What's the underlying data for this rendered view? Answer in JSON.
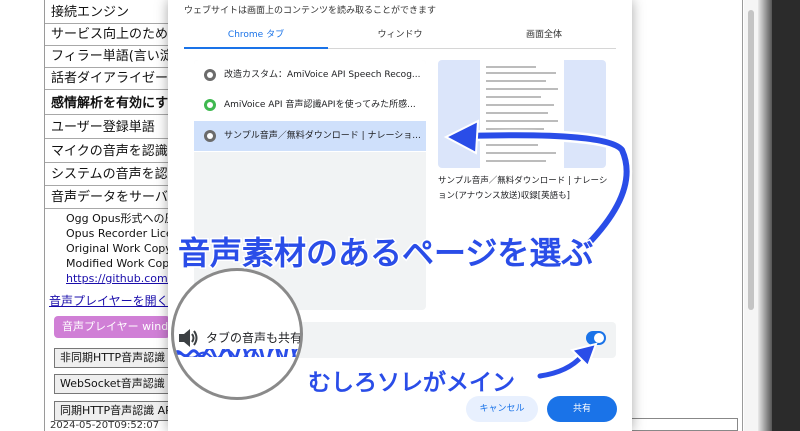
{
  "background": {
    "rows": [
      {
        "label": "接続エンジン",
        "bold": false
      },
      {
        "label": "サービス向上のため",
        "bold": false
      },
      {
        "label": "フィラー単語(言い淀",
        "bold": false
      },
      {
        "label": "話者ダイアライゼーシ",
        "bold": false
      },
      {
        "label": "感情解析を有効にする",
        "bold": true
      },
      {
        "label": "ユーザー登録単語",
        "bold": false
      },
      {
        "label": "マイクの音声を認識す",
        "bold": false
      },
      {
        "label": "システムの音声を認識",
        "bold": false
      },
      {
        "label": "音声データをサーバー",
        "bold": false
      }
    ],
    "sub_lines": [
      {
        "text": "Ogg Opus形式への圧",
        "link": false
      },
      {
        "text": "Opus Recorder Lice",
        "link": false
      },
      {
        "text": "Original Work Copy",
        "link": false
      },
      {
        "text": "Modified Work Copy",
        "link": false
      },
      {
        "text": "https://github.com/c",
        "link": true
      }
    ],
    "player_link": "音声プレイヤーを開く",
    "player_button": "音声プレイヤー window",
    "buttons": [
      "非同期HTTP音声認識",
      "WebSocket音声認識",
      "同期HTTP音声認識 AP"
    ],
    "bottom_text": "2024-05-20T09:52:07"
  },
  "dialog": {
    "description": "ウェブサイトは画面上のコンテンツを読み取ることができます",
    "tabs": [
      {
        "label": "Chrome タブ",
        "active": true
      },
      {
        "label": "ウィンドウ",
        "active": false
      },
      {
        "label": "画面全体",
        "active": false
      }
    ],
    "tab_items": [
      {
        "title": "改造カスタム：AmiVoice API Speech Recog...",
        "favicon": "globe-icon",
        "selected": false
      },
      {
        "title": "AmiVoice API 音声認識APIを使ってみた所感...",
        "favicon": "q-icon",
        "selected": false
      },
      {
        "title": "サンプル音声／無料ダウンロード | ナレーショ...",
        "favicon": "globe-icon",
        "selected": true
      }
    ],
    "preview_caption": "サンプル音声／無料ダウンロード | ナレーション(アナウンス放送)収録[英語も]",
    "audio_share_label": "タブの音声も共有",
    "audio_share_on": true,
    "cancel_label": "キャンセル",
    "share_label": "共有"
  },
  "annotations": {
    "big": "音声素材のあるページを選ぶ",
    "small": "むしろソレがメイン",
    "color": "#2a4de8"
  },
  "colors": {
    "accent": "#1a73e8",
    "selected_row": "#cfe0fb",
    "pill": "#d07fd6"
  }
}
